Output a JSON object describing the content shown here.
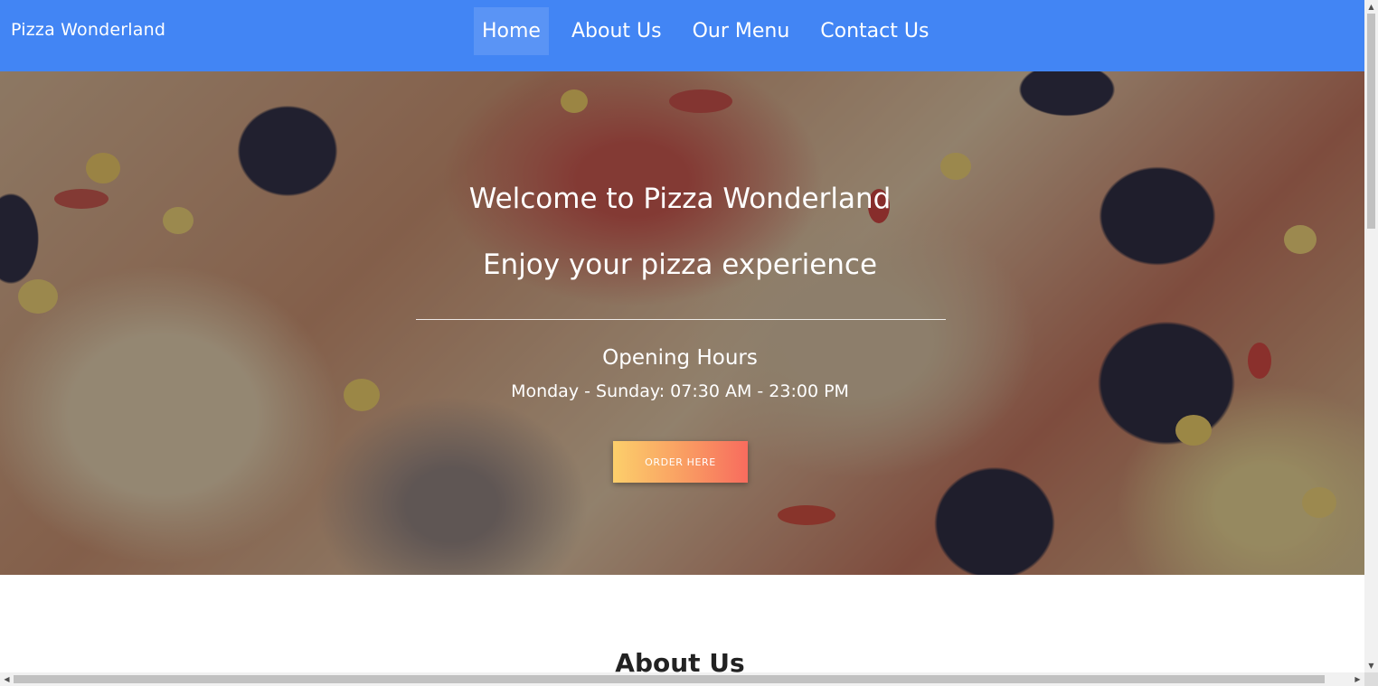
{
  "navbar": {
    "brand": "Pizza Wonderland",
    "links": [
      {
        "label": "Home",
        "active": true
      },
      {
        "label": "About Us",
        "active": false
      },
      {
        "label": "Our Menu",
        "active": false
      },
      {
        "label": "Contact Us",
        "active": false
      }
    ],
    "color": "#4285f4"
  },
  "hero": {
    "title": "Welcome to Pizza Wonderland",
    "tagline": "Enjoy your pizza experience",
    "hours_title": "Opening Hours",
    "hours": "Monday - Sunday: 07:30 AM - 23:00 PM",
    "order_button": "ORDER HERE",
    "button_gradient": [
      "#fccf6b",
      "#f86c5e"
    ]
  },
  "about": {
    "title": "About Us"
  },
  "scrollbars": {
    "up_icon": "▲",
    "down_icon": "▼",
    "left_icon": "◀",
    "right_icon": "▶"
  }
}
